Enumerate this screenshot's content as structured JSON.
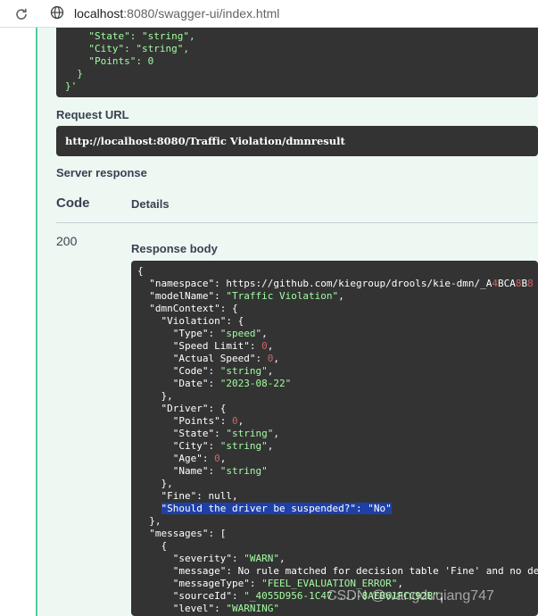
{
  "browser": {
    "url_host": "localhost",
    "url_rest": ":8080/swagger-ui/index.html"
  },
  "request_body_tail": {
    "lines": [
      [
        "    ",
        "\"State\": \"string\","
      ],
      [
        "    ",
        "\"City\": \"string\","
      ],
      [
        "    ",
        "\"Points\": 0"
      ],
      [
        "  ",
        "}"
      ],
      [
        "",
        "}'"
      ]
    ]
  },
  "labels": {
    "request_url": "Request URL",
    "server_response": "Server response",
    "code_header": "Code",
    "details_header": "Details",
    "response_body": "Response body"
  },
  "request_url": "http://localhost:8080/Traffic Violation/dmnresult",
  "response": {
    "code": "200",
    "body_lines": [
      "{",
      "  \"namespace\": \"https://github.com/kiegroup/drools/kie-dmn/_A4BCA8B8",
      "  \"modelName\": \"Traffic Violation\",",
      "  \"dmnContext\": {",
      "    \"Violation\": {",
      "      \"Type\": \"speed\",",
      "      \"Speed Limit\": 0,",
      "      \"Actual Speed\": 0,",
      "      \"Code\": \"string\",",
      "      \"Date\": \"2023-08-22\"",
      "    },",
      "    \"Driver\": {",
      "      \"Points\": 0,",
      "      \"State\": \"string\",",
      "      \"City\": \"string\",",
      "      \"Age\": 0,",
      "      \"Name\": \"string\"",
      "    },",
      "    \"Fine\": null,",
      "    \"Should the driver be suspended?\": \"No\"",
      "  },",
      "  \"messages\": [",
      "    {",
      "      \"severity\": \"WARN\",",
      "      \"message\": \"No rule matched for decision table 'Fine' and no de",
      "      \"messageType\": \"FEEL_EVALUATION_ERROR\",",
      "      \"sourceId\": \"_4055D956-1C47-...-8AEB61FCC92B\",",
      "      \"level\": \"WARNING\""
    ],
    "highlighted_line": 19
  },
  "watermark": "CSDN @wangduqiang747",
  "colors": {
    "accent_green": "#49cc90",
    "panel_bg": "#edf8f3",
    "code_bg": "#333333",
    "string_green": "#a2fca2",
    "number_red": "#d36363",
    "selection_blue": "#1e40a8"
  }
}
